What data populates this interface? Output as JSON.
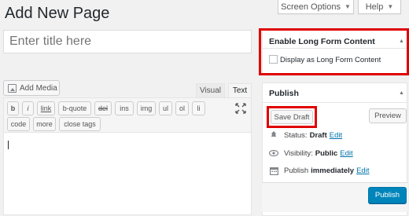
{
  "header": {
    "title": "Add New Page",
    "screen_options_label": "Screen Options",
    "help_label": "Help"
  },
  "title_input": {
    "placeholder": "Enter title here",
    "value": ""
  },
  "editor": {
    "add_media_label": "Add Media",
    "tabs": {
      "visual": "Visual",
      "text": "Text",
      "active": "Text"
    },
    "quicktags": {
      "b": "b",
      "i": "i",
      "link": "link",
      "bquote": "b-quote",
      "del": "del",
      "ins": "ins",
      "img": "img",
      "ul": "ul",
      "ol": "ol",
      "li": "li",
      "code": "code",
      "more": "more",
      "close": "close tags"
    },
    "content": ""
  },
  "long_form_box": {
    "title": "Enable Long Form Content",
    "checkbox_label": "Display as Long Form Content",
    "checked": false
  },
  "publish_box": {
    "title": "Publish",
    "save_draft_label": "Save Draft",
    "preview_label": "Preview",
    "status_label": "Status:",
    "status_value": "Draft",
    "visibility_label": "Visibility:",
    "visibility_value": "Public",
    "publish_time_label": "Publish",
    "publish_time_value": "immediately",
    "edit_label": "Edit",
    "publish_button_label": "Publish"
  },
  "colors": {
    "highlight": "#e00000",
    "primary": "#0085ba",
    "link": "#0073aa",
    "background": "#f1f1f1"
  },
  "icons": [
    "media-icon",
    "fullscreen-icon",
    "collapse-toggle-icon",
    "pin-icon",
    "eye-icon",
    "calendar-icon"
  ]
}
